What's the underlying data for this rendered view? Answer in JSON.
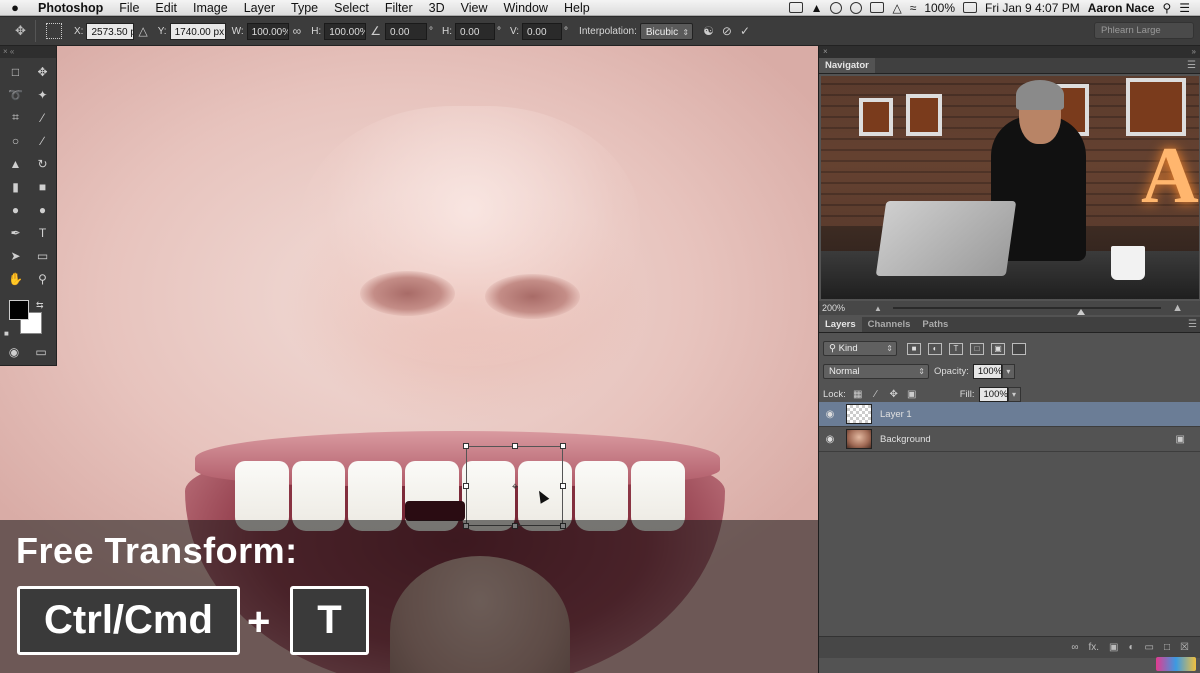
{
  "menubar": {
    "apple": "",
    "app": "Photoshop",
    "items": [
      "File",
      "Edit",
      "Image",
      "Layer",
      "Type",
      "Select",
      "Filter",
      "3D",
      "View",
      "Window",
      "Help"
    ],
    "battery": "100%",
    "datetime": "Fri Jan 9  4:07 PM",
    "user": "Aaron Nace"
  },
  "options": {
    "x_label": "X:",
    "x_value": "2573.50 px",
    "y_label": "Y:",
    "y_value": "1740.00 px",
    "w_label": "W:",
    "w_value": "100.00%",
    "h_label": "H:",
    "h_value": "100.00%",
    "rotate_value": "0.00",
    "deg": "°",
    "hskew_label": "H:",
    "hskew_value": "0.00",
    "vskew_label": "V:",
    "vskew_value": "0.00",
    "interp_label": "Interpolation:",
    "interp_value": "Bicubic",
    "workspace": "Phlearn Large"
  },
  "caption": {
    "title": "Free Transform:",
    "key1": "Ctrl/Cmd",
    "plus": "+",
    "key2": "T"
  },
  "navigator": {
    "tab": "Navigator",
    "zoom": "200%",
    "zoom_fraction": 0.7
  },
  "layers_panel": {
    "tabs": [
      "Layers",
      "Channels",
      "Paths"
    ],
    "filter_kind": "Kind",
    "blend_mode": "Normal",
    "opacity_label": "Opacity:",
    "opacity_value": "100%",
    "lock_label": "Lock:",
    "fill_label": "Fill:",
    "fill_value": "100%",
    "layers": [
      {
        "name": "Layer 1",
        "selected": true
      },
      {
        "name": "Background",
        "selected": false
      }
    ]
  },
  "colors": {
    "selected_layer": "#6b7d96",
    "panel_bg": "#535353"
  }
}
